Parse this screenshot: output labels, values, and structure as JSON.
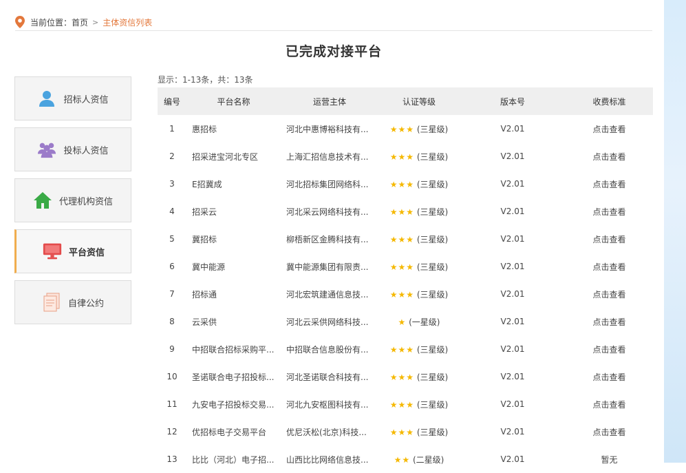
{
  "breadcrumb": {
    "prefix": "当前位置：",
    "home": "首页",
    "separator": ">",
    "current": "主体资信列表"
  },
  "page_title": "已完成对接平台",
  "sidebar": {
    "items": [
      {
        "label": "招标人资信",
        "icon": "user-icon"
      },
      {
        "label": "投标人资信",
        "icon": "group-icon"
      },
      {
        "label": "代理机构资信",
        "icon": "home-icon"
      },
      {
        "label": "平台资信",
        "icon": "monitor-icon",
        "active": true
      },
      {
        "label": "自律公约",
        "icon": "document-icon"
      }
    ]
  },
  "summary": "显示：1-13条，共：13条",
  "table": {
    "headers": [
      "编号",
      "平台名称",
      "运营主体",
      "认证等级",
      "版本号",
      "收费标准"
    ],
    "rows": [
      {
        "num": "1",
        "name": "惠招标",
        "operator": "河北中惠博裕科技有...",
        "stars": "★★★",
        "level": "(三星级)",
        "version": "V2.01",
        "fee": "点击查看"
      },
      {
        "num": "2",
        "name": "招采进宝河北专区",
        "operator": "上海汇招信息技术有...",
        "stars": "★★★",
        "level": "(三星级)",
        "version": "V2.01",
        "fee": "点击查看"
      },
      {
        "num": "3",
        "name": "E招冀成",
        "operator": "河北招标集团网络科...",
        "stars": "★★★",
        "level": "(三星级)",
        "version": "V2.01",
        "fee": "点击查看"
      },
      {
        "num": "4",
        "name": "招采云",
        "operator": "河北采云网络科技有...",
        "stars": "★★★",
        "level": "(三星级)",
        "version": "V2.01",
        "fee": "点击查看"
      },
      {
        "num": "5",
        "name": "冀招标",
        "operator": "柳梧新区金腾科技有...",
        "stars": "★★★",
        "level": "(三星级)",
        "version": "V2.01",
        "fee": "点击查看"
      },
      {
        "num": "6",
        "name": "冀中能源",
        "operator": "冀中能源集团有限责...",
        "stars": "★★★",
        "level": "(三星级)",
        "version": "V2.01",
        "fee": "点击查看"
      },
      {
        "num": "7",
        "name": "招标通",
        "operator": "河北宏筑建通信息技...",
        "stars": "★★★",
        "level": "(三星级)",
        "version": "V2.01",
        "fee": "点击查看"
      },
      {
        "num": "8",
        "name": "云采供",
        "operator": "河北云采供网络科技...",
        "stars": "★",
        "level": "(一星级)",
        "version": "V2.01",
        "fee": "点击查看"
      },
      {
        "num": "9",
        "name": "中招联合招标采购平...",
        "operator": "中招联合信息股份有...",
        "stars": "★★★",
        "level": "(三星级)",
        "version": "V2.01",
        "fee": "点击查看"
      },
      {
        "num": "10",
        "name": "圣诺联合电子招投标...",
        "operator": "河北圣诺联合科技有...",
        "stars": "★★★",
        "level": "(三星级)",
        "version": "V2.01",
        "fee": "点击查看"
      },
      {
        "num": "11",
        "name": "九安电子招投标交易...",
        "operator": "河北九安枢图科技有...",
        "stars": "★★★",
        "level": "(三星级)",
        "version": "V2.01",
        "fee": "点击查看"
      },
      {
        "num": "12",
        "name": "优招标电子交易平台",
        "operator": "优尼沃松(北京)科技...",
        "stars": "★★★",
        "level": "(三星级)",
        "version": "V2.01",
        "fee": "点击查看"
      },
      {
        "num": "13",
        "name": "比比（河北）电子招...",
        "operator": "山西比比网络信息技...",
        "stars": "★★",
        "level": "(二星级)",
        "version": "V2.01",
        "fee": "暂无"
      }
    ]
  },
  "colors": {
    "accent_orange": "#e3783c",
    "star": "#f5b800",
    "header_bg": "#efefef"
  }
}
